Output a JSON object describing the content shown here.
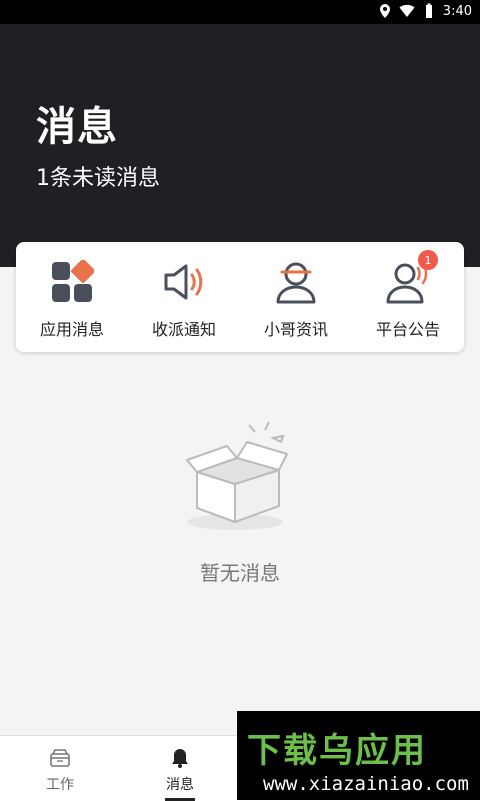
{
  "status_bar": {
    "time": "3:40"
  },
  "header": {
    "title": "消息",
    "subtitle": "1条未读消息"
  },
  "categories": [
    {
      "label": "应用消息",
      "icon": "apps-grid-icon"
    },
    {
      "label": "收派通知",
      "icon": "speaker-icon"
    },
    {
      "label": "小哥资讯",
      "icon": "courier-person-icon"
    },
    {
      "label": "平台公告",
      "icon": "announcement-person-icon",
      "badge": "1"
    }
  ],
  "empty_state": {
    "text": "暂无消息"
  },
  "bottom_nav": [
    {
      "label": "工作",
      "icon": "work-box-icon",
      "active": false
    },
    {
      "label": "消息",
      "icon": "bell-icon",
      "active": true
    }
  ],
  "watermark": {
    "title": "下载乌应用",
    "url": "www.xiazainiao.com"
  },
  "colors": {
    "header_bg": "#1f2024",
    "accent": "#e8734a",
    "badge": "#f05a4b"
  }
}
